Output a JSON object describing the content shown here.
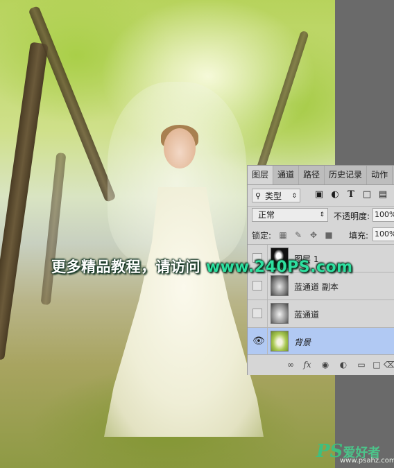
{
  "watermark": {
    "text": "更多精品教程，请访问",
    "site": "www.240PS.com"
  },
  "logo": {
    "ps": "PS",
    "cn": "爱好者",
    "url": "www.psahz.com"
  },
  "panel": {
    "tabs": [
      "图层",
      "通道",
      "路径",
      "历史记录",
      "动作"
    ],
    "filter": {
      "icon": "search-icon",
      "value": "类型"
    },
    "filter_icons": [
      "image-filter-icon",
      "adjustment-filter-icon",
      "type-filter-icon",
      "shape-filter-icon",
      "smart-object-filter-icon"
    ],
    "blend_mode": "正常",
    "opacity_label": "不透明度:",
    "opacity_value": "100%",
    "lock_label": "锁定:",
    "fill_label": "填充:",
    "fill_value": "100%",
    "layers": [
      {
        "name": "图层 1",
        "visible": false,
        "selected": false
      },
      {
        "name": "蓝通道 副本",
        "visible": false,
        "selected": false
      },
      {
        "name": "蓝通道",
        "visible": false,
        "selected": false
      },
      {
        "name": "背景",
        "visible": true,
        "selected": true
      }
    ],
    "bottom_icons": [
      "link-icon",
      "fx-icon",
      "mask-icon",
      "adjustment-icon",
      "group-folder-icon",
      "new-layer-icon",
      "trash-icon"
    ]
  },
  "colors": {
    "selected_layer": "#b1c9f3",
    "watermark_site": "#2ee0a0",
    "logo_green": "#3fbf7f"
  }
}
